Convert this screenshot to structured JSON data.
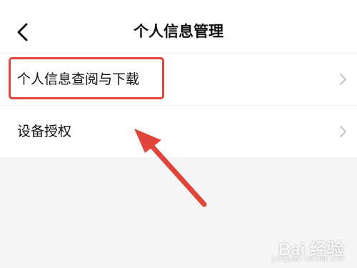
{
  "status_bar": {
    "left_fragment": "",
    "right_fragment": ""
  },
  "nav": {
    "title": "个人信息管理",
    "back_icon": "chevron-left-icon"
  },
  "list": {
    "items": [
      {
        "label": "个人信息查阅与下载",
        "icon": "chevron-right-icon",
        "highlighted": true
      },
      {
        "label": "设备授权",
        "icon": "chevron-right-icon",
        "highlighted": false
      }
    ]
  },
  "annotation": {
    "color": "#e0443a"
  },
  "watermark": {
    "text": "Bai 经验",
    "subtext": "jingyan.baidu.com"
  }
}
